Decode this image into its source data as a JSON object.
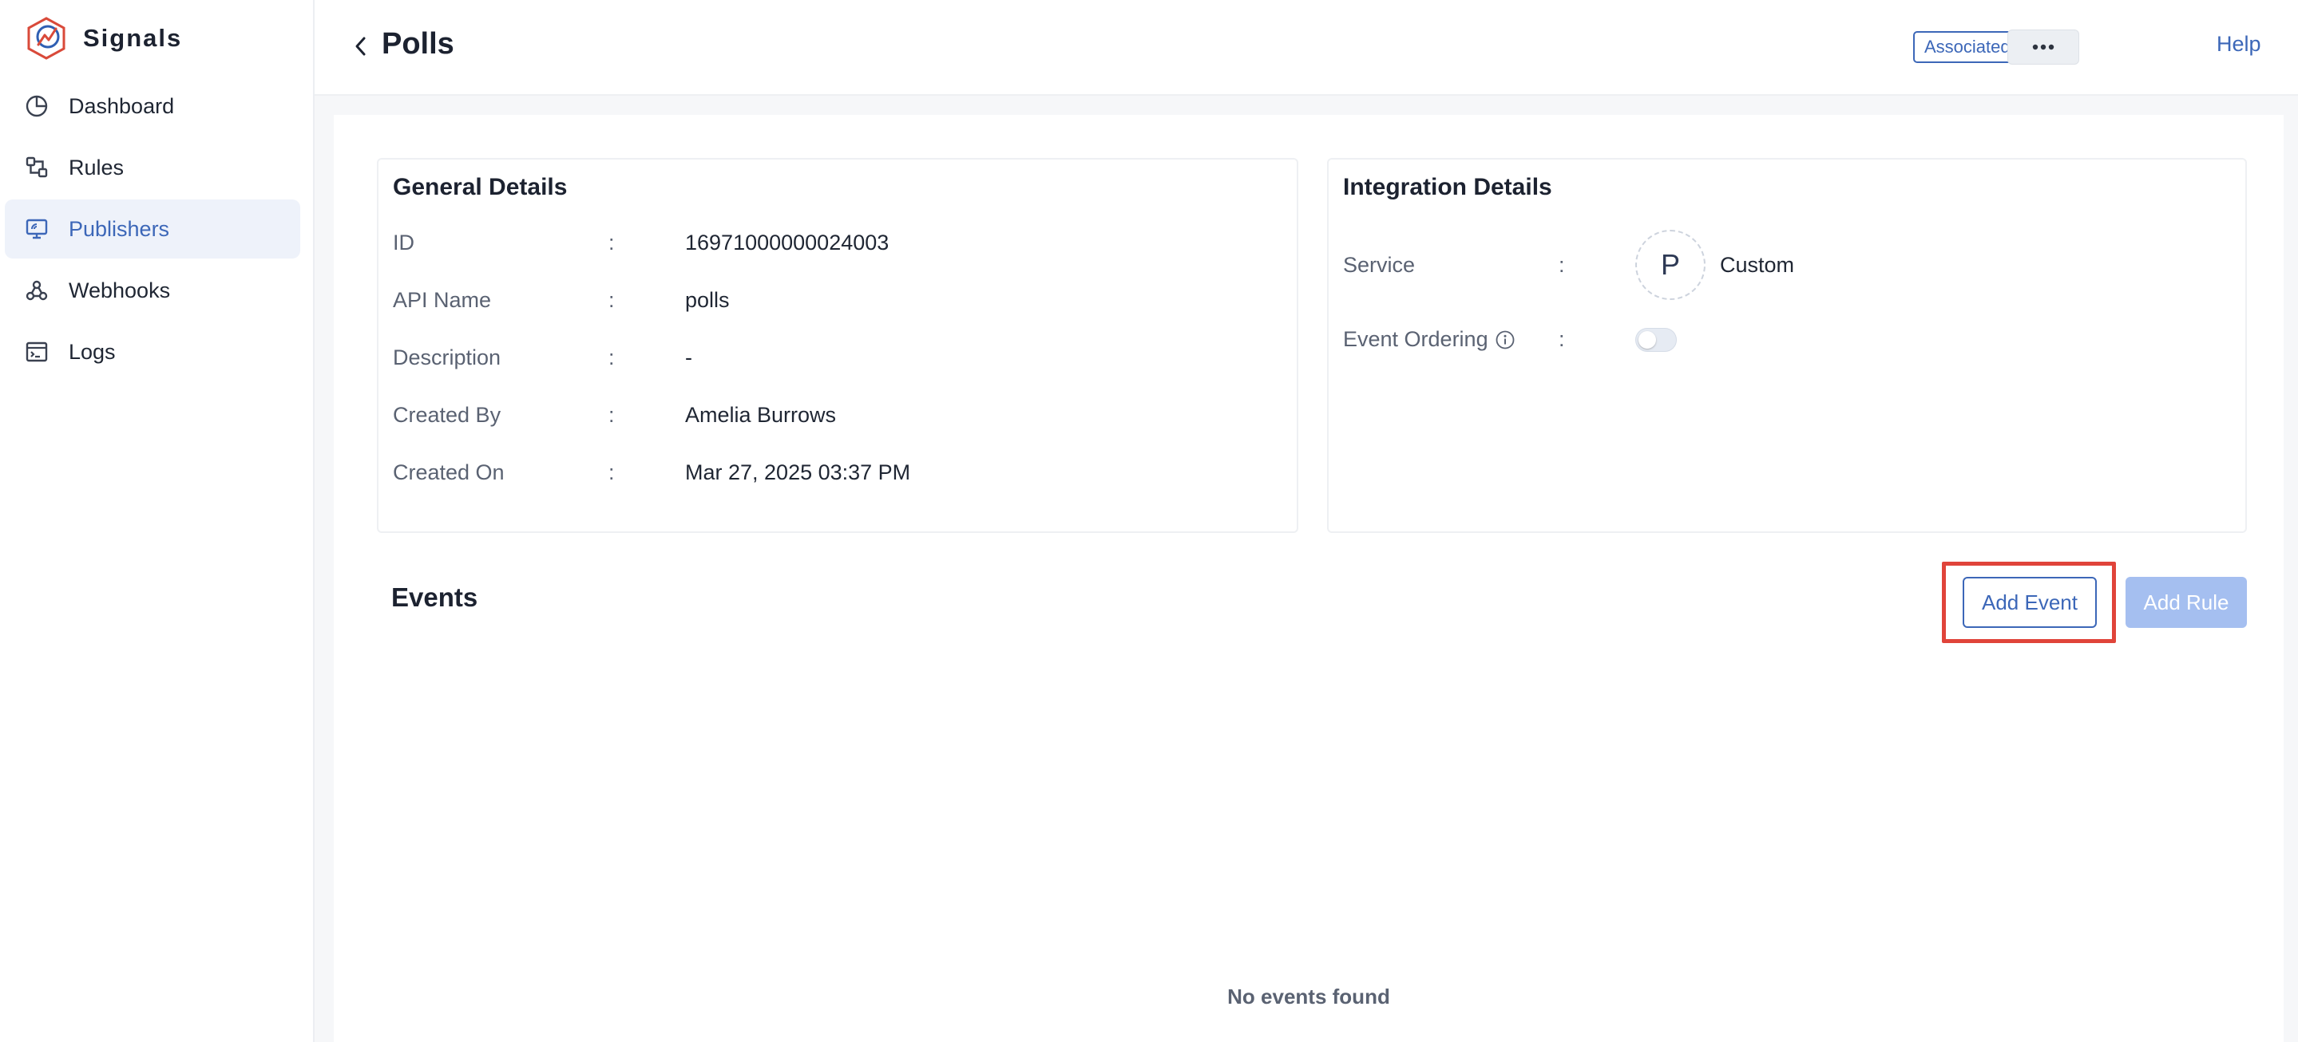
{
  "app": {
    "name": "Signals"
  },
  "sidebar": {
    "items": [
      {
        "label": "Dashboard",
        "icon": "dashboard-icon"
      },
      {
        "label": "Rules",
        "icon": "rules-icon"
      },
      {
        "label": "Publishers",
        "icon": "publishers-icon",
        "active": true
      },
      {
        "label": "Webhooks",
        "icon": "webhooks-icon"
      },
      {
        "label": "Logs",
        "icon": "logs-icon"
      }
    ]
  },
  "header": {
    "title": "Polls",
    "associated_rules_label": "Associated Rules",
    "more_label": "•••",
    "help_label": "Help"
  },
  "general": {
    "title": "General Details",
    "rows": [
      {
        "label": "ID",
        "value": "16971000000024003"
      },
      {
        "label": "API Name",
        "value": "polls"
      },
      {
        "label": "Description",
        "value": "-"
      },
      {
        "label": "Created By",
        "value": "Amelia Burrows"
      },
      {
        "label": "Created On",
        "value": "Mar 27, 2025 03:37 PM"
      }
    ]
  },
  "integration": {
    "title": "Integration Details",
    "service_label": "Service",
    "service_initial": "P",
    "service_value": "Custom",
    "ordering_label": "Event Ordering",
    "ordering_enabled": false
  },
  "separator": ":",
  "events": {
    "title": "Events",
    "add_event_label": "Add Event",
    "add_rule_label": "Add Rule",
    "empty_text": "No events found"
  },
  "colors": {
    "accent": "#3c67b8",
    "highlight": "#e0443a",
    "disabled_button": "#a5bff0"
  }
}
